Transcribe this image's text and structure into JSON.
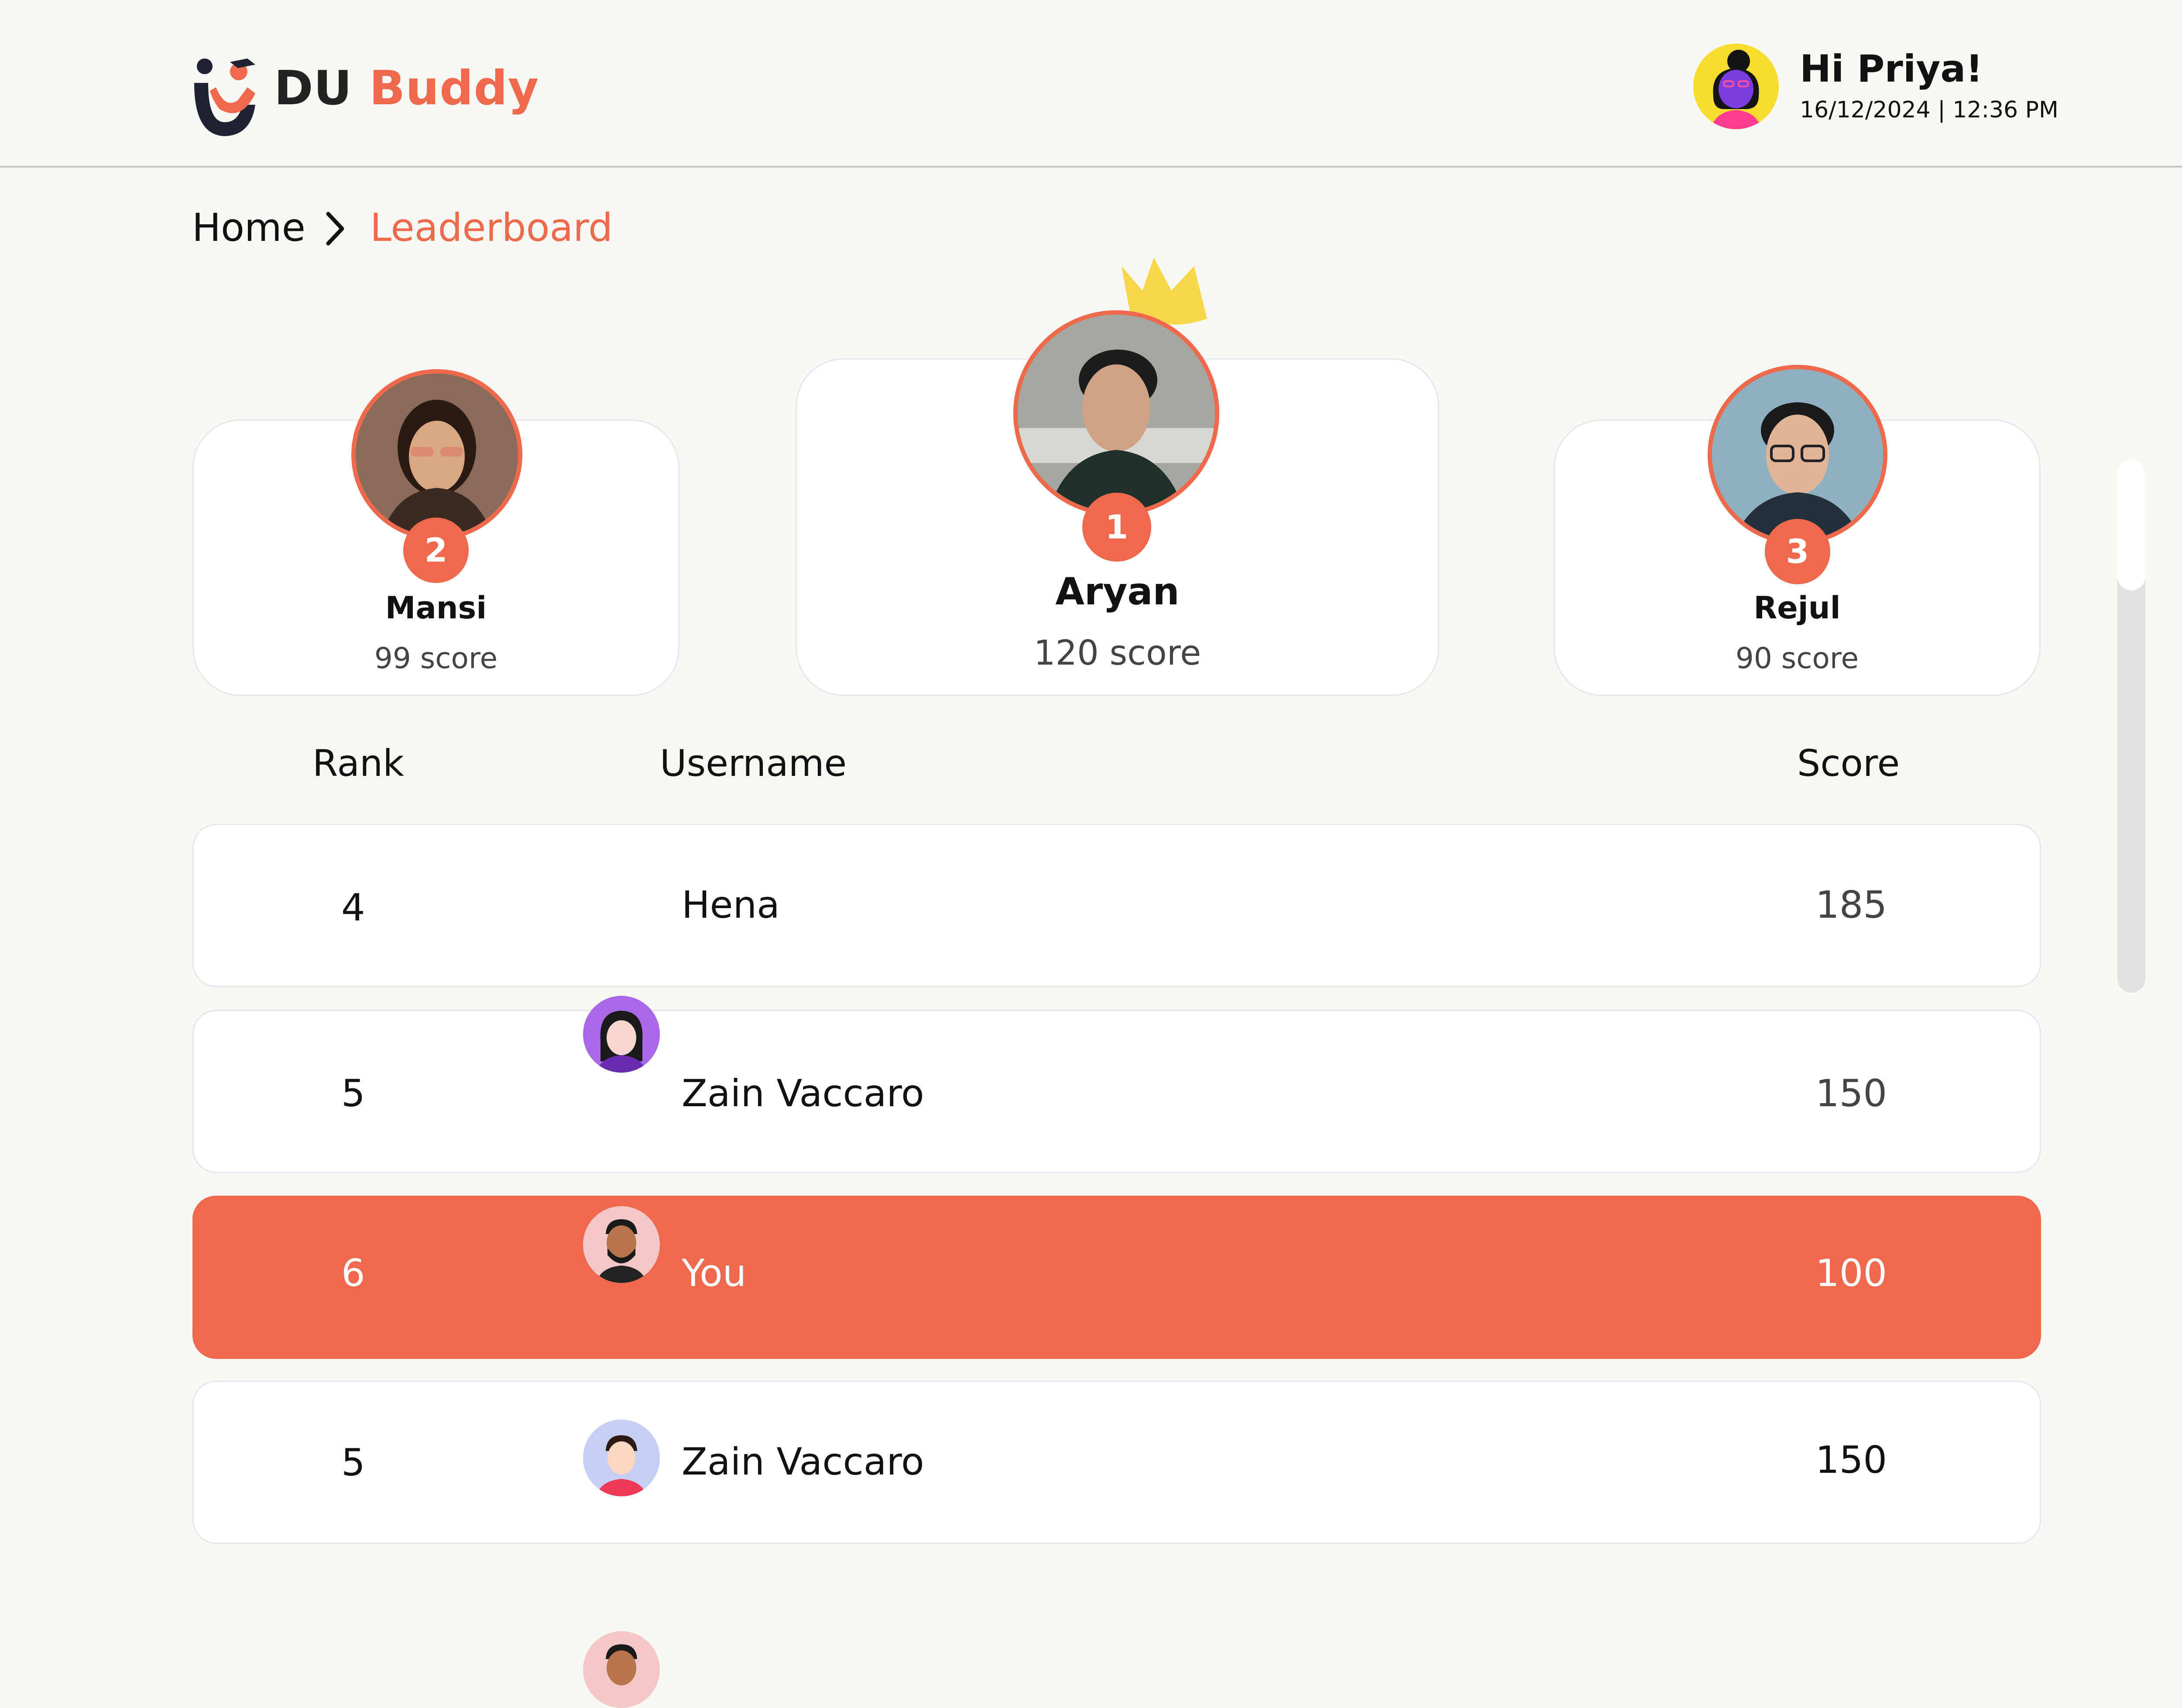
{
  "header": {
    "logo_du": "DU",
    "logo_buddy": "Buddy",
    "greeting": "Hi Priya!",
    "datetime": "16/12/2024 | 12:36 PM"
  },
  "breadcrumb": {
    "home": "Home",
    "current": "Leaderboard"
  },
  "podium": [
    {
      "rank": "2",
      "name": "Mansi",
      "score": "99 score"
    },
    {
      "rank": "1",
      "name": "Aryan",
      "score": "120 score"
    },
    {
      "rank": "3",
      "name": "Rejul",
      "score": "90 score"
    }
  ],
  "table": {
    "columns": [
      "Rank",
      "Username",
      "Score"
    ],
    "rows": [
      {
        "rank": "4",
        "username": "Hena",
        "score": "185"
      },
      {
        "rank": "5",
        "username": "Zain Vaccaro",
        "score": "150"
      },
      {
        "rank": "6",
        "username": "You",
        "score": "100",
        "highlighted": true
      },
      {
        "rank": "5",
        "username": "Zain Vaccaro",
        "score": "150"
      }
    ]
  },
  "colors": {
    "accent": "#ef6a4c",
    "background": "#f9f8f4",
    "crown": "#f8d64a"
  }
}
